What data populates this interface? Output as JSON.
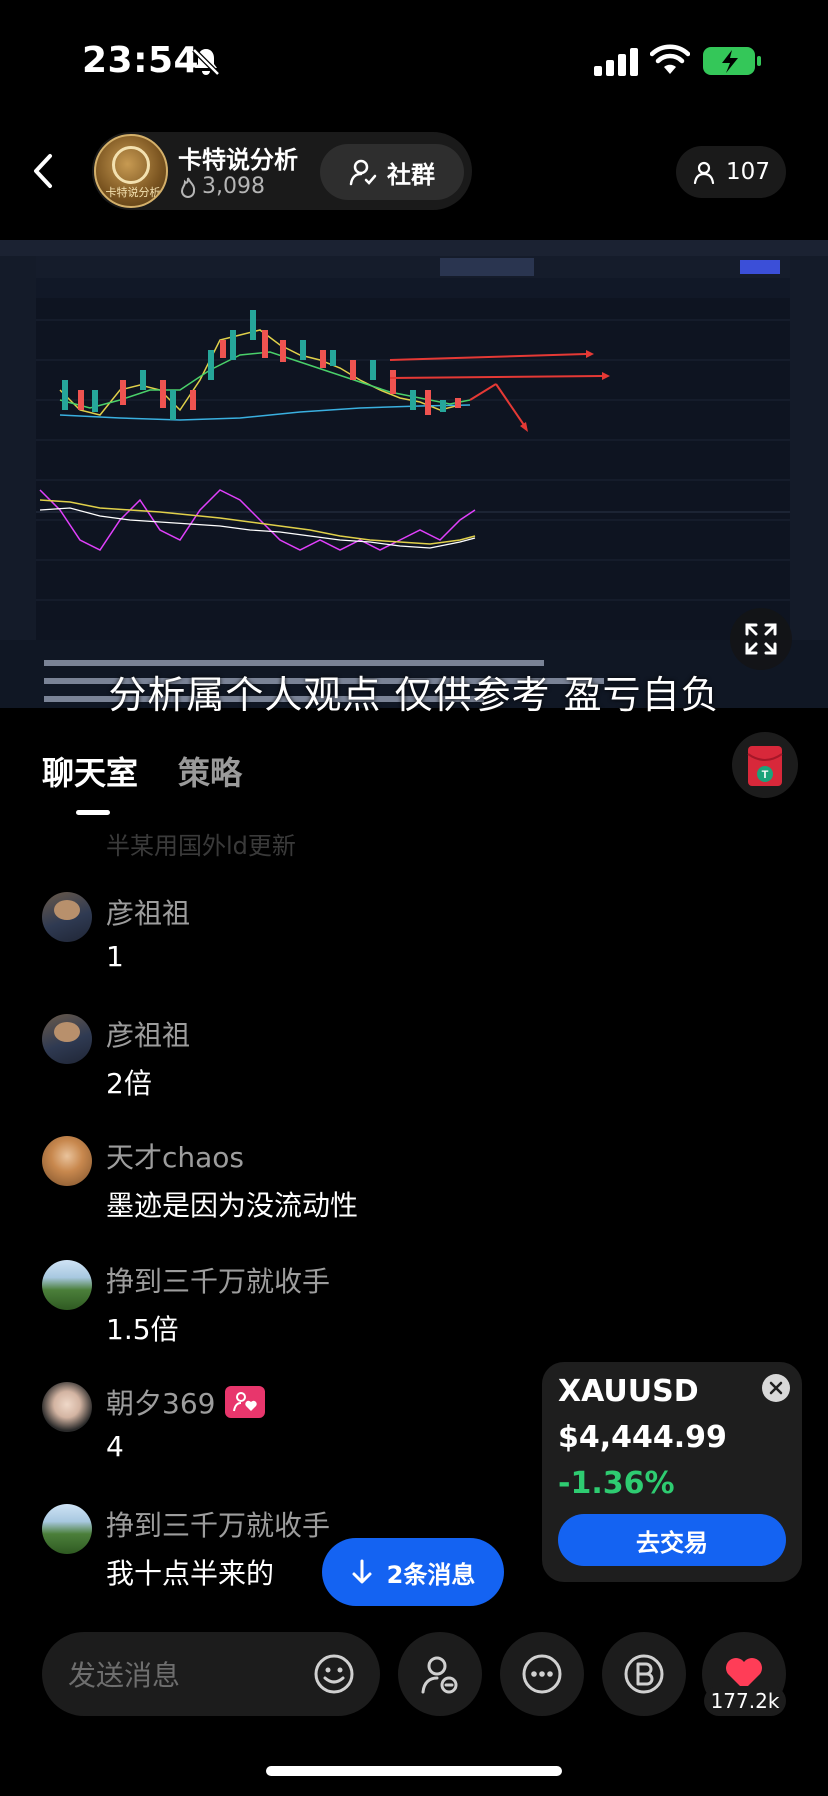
{
  "status": {
    "time": "23:54"
  },
  "host": {
    "name": "卡特说分析",
    "fans": "3,098",
    "logo_text": "卡特说分析"
  },
  "header": {
    "group_label": "社群",
    "viewers": "107"
  },
  "stream": {
    "subtitle": "分析属个人观点 仅供参考 盈亏自负"
  },
  "tabs": [
    {
      "label": "聊天室"
    },
    {
      "label": "策略"
    }
  ],
  "chat": {
    "faded_text": "半某用国外ld更新",
    "messages": [
      {
        "user": "彦祖祖",
        "text": "1"
      },
      {
        "user": "彦祖祖",
        "text": "2倍"
      },
      {
        "user": "天才chaos",
        "text": "墨迹是因为没流动性"
      },
      {
        "user": "挣到三千万就收手",
        "text": "1.5倍"
      },
      {
        "user": "朝夕369",
        "text": "4"
      },
      {
        "user": "挣到三千万就收手",
        "text": "我十点半来的"
      }
    ],
    "new_messages": "2条消息"
  },
  "ticker": {
    "symbol": "XAUUSD",
    "price": "$4,444.99",
    "change": "-1.36%",
    "trade_label": "去交易",
    "change_color": "#2ecc71"
  },
  "bottom": {
    "input_placeholder": "发送消息",
    "like_count": "177.2k"
  },
  "colors": {
    "accent": "#1463f2",
    "heart": "#ff3d57"
  }
}
